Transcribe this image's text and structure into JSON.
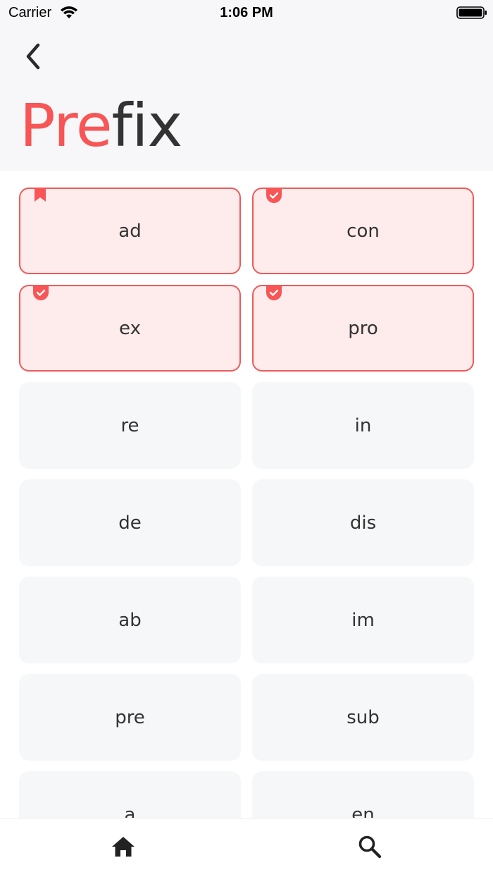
{
  "status_bar": {
    "carrier": "Carrier",
    "time": "1:06 PM",
    "icons": [
      "wifi-icon",
      "battery-icon"
    ]
  },
  "header": {
    "back_icon": "chevron-left-icon",
    "title_accent": "Pre",
    "title_rest": "fix"
  },
  "colors": {
    "accent": "#f75556",
    "selected_fill": "#feebec",
    "selected_border": "#ef5a5a",
    "tile_fill": "#f6f7f9",
    "text": "#333333"
  },
  "tiles": [
    {
      "label": "ad",
      "state": "selected",
      "mark": "bookmark-icon"
    },
    {
      "label": "con",
      "state": "selected",
      "mark": "check-badge-icon"
    },
    {
      "label": "ex",
      "state": "selected",
      "mark": "check-badge-icon"
    },
    {
      "label": "pro",
      "state": "selected",
      "mark": "check-badge-icon"
    },
    {
      "label": "re",
      "state": "default"
    },
    {
      "label": "in",
      "state": "default"
    },
    {
      "label": "de",
      "state": "default"
    },
    {
      "label": "dis",
      "state": "default"
    },
    {
      "label": "ab",
      "state": "default"
    },
    {
      "label": "im",
      "state": "default"
    },
    {
      "label": "pre",
      "state": "default"
    },
    {
      "label": "sub",
      "state": "default"
    },
    {
      "label": "a",
      "state": "default"
    },
    {
      "label": "en",
      "state": "default"
    }
  ],
  "bottom_nav": {
    "items": [
      {
        "icon": "home-icon"
      },
      {
        "icon": "search-icon"
      }
    ]
  }
}
